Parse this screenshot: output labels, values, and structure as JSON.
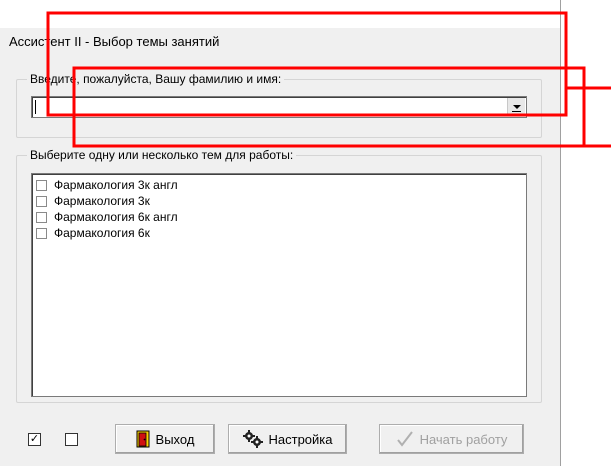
{
  "window": {
    "title": "Ассистент II - Выбор темы занятий"
  },
  "name_group": {
    "legend": "Введите, пожалуйста, Вашу фамилию и имя:",
    "input_value": ""
  },
  "topics_group": {
    "legend": "Выберите одну или несколько тем для работы:",
    "items": [
      {
        "label": "Фармакология 3к англ",
        "checked": false
      },
      {
        "label": "Фармакология 3к",
        "checked": false
      },
      {
        "label": "Фармакология 6к англ",
        "checked": false
      },
      {
        "label": "Фармакология 6к",
        "checked": false
      }
    ]
  },
  "bottom_bar": {
    "check_all_mark": "✓",
    "check_none_mark": "",
    "exit_label": "Выход",
    "settings_label": "Настройка",
    "start_label": "Начать работу"
  },
  "colors": {
    "window_bg": "#f0f0f0",
    "annotation_red": "#ff0000",
    "exit_icon_yellow": "#ffd200",
    "exit_icon_red": "#d01010"
  }
}
